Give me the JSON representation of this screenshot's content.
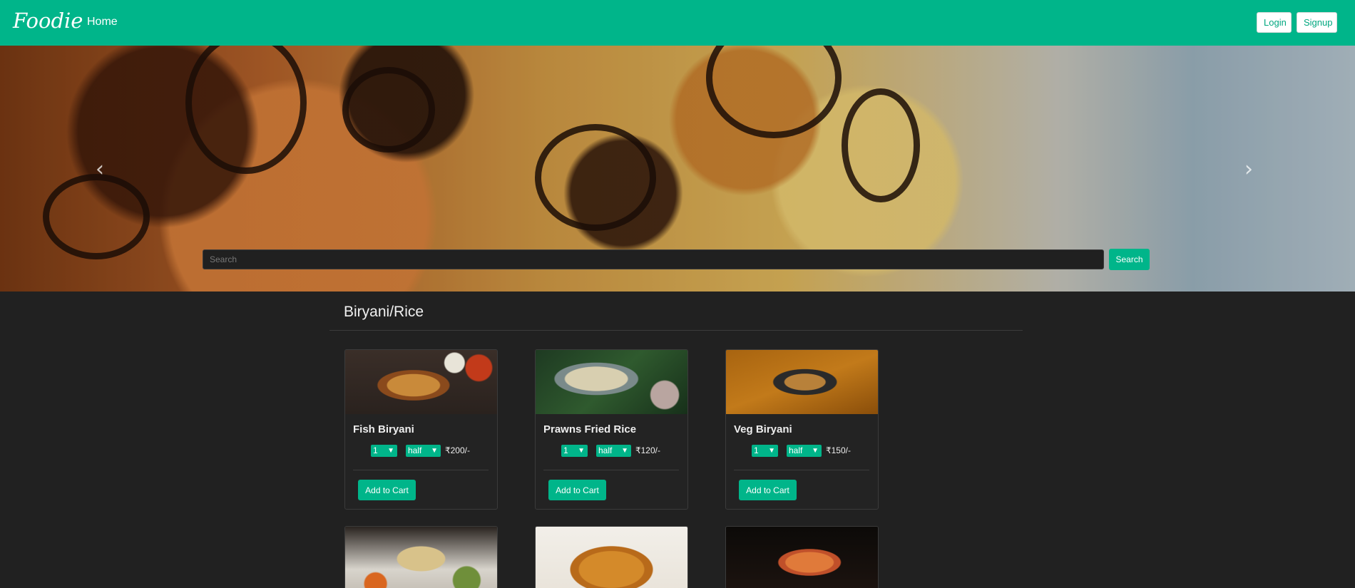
{
  "navbar": {
    "brand": "Foodie",
    "home_label": "Home",
    "login_label": "Login",
    "signup_label": "Signup"
  },
  "hero": {
    "prev_icon": "‹",
    "next_icon": "›",
    "search_placeholder": "Search",
    "search_button_label": "Search"
  },
  "section": {
    "title": "Biryani/Rice"
  },
  "cards": [
    {
      "name": "Fish Biryani",
      "qty": "1",
      "size": "half",
      "price": "₹200/-",
      "add_label": "Add to Cart"
    },
    {
      "name": "Prawns Fried Rice",
      "qty": "1",
      "size": "half",
      "price": "₹120/-",
      "add_label": "Add to Cart"
    },
    {
      "name": "Veg Biryani",
      "qty": "1",
      "size": "half",
      "price": "₹150/-",
      "add_label": "Add to Cart"
    }
  ],
  "icons": {
    "chevron": "chevron-down-icon",
    "prev": "chevron-left-icon",
    "next": "chevron-right-icon"
  },
  "colors": {
    "accent": "#00b58a",
    "background": "#212121"
  }
}
